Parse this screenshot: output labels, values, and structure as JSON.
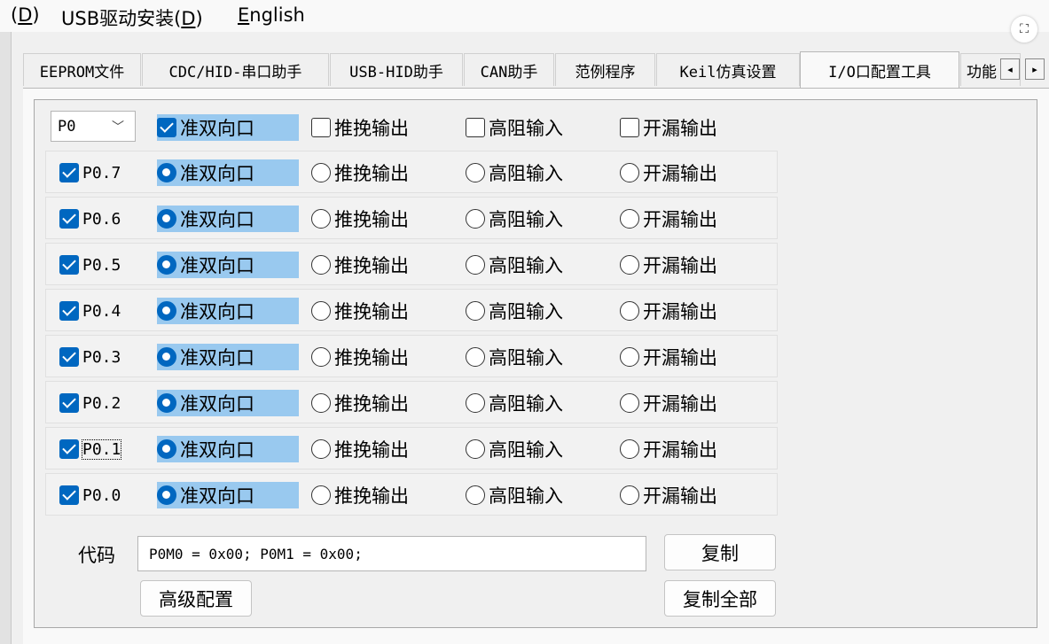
{
  "menu": {
    "items": [
      {
        "prefix": "",
        "hotkey": "D",
        "suffix": ")"
      },
      {
        "prefix": "USB驱动安装(",
        "hotkey": "D",
        "suffix": ")"
      },
      {
        "prefix": "",
        "hotkey": "E",
        "suffix": "nglish"
      }
    ]
  },
  "corner_icon": "⛶",
  "tabs": [
    {
      "label": "EEPROM文件"
    },
    {
      "label": "CDC/HID-串口助手"
    },
    {
      "label": "USB-HID助手"
    },
    {
      "label": "CAN助手"
    },
    {
      "label": "范例程序"
    },
    {
      "label": "Keil仿真设置"
    },
    {
      "label": "I/O口配置工具",
      "active": true
    },
    {
      "label": "功能"
    }
  ],
  "tab_scroll": {
    "left": "◂",
    "right": "▸"
  },
  "port_select": {
    "value": "P0",
    "chevron": "﹀"
  },
  "header_options": [
    {
      "label": "准双向口",
      "checked": true
    },
    {
      "label": "推挽输出",
      "checked": false
    },
    {
      "label": "高阻输入",
      "checked": false
    },
    {
      "label": "开漏输出",
      "checked": false
    }
  ],
  "mode_labels": [
    "准双向口",
    "推挽输出",
    "高阻输入",
    "开漏输出"
  ],
  "pins": [
    {
      "label": "P0.7",
      "enabled": true,
      "mode": 0
    },
    {
      "label": "P0.6",
      "enabled": true,
      "mode": 0
    },
    {
      "label": "P0.5",
      "enabled": true,
      "mode": 0
    },
    {
      "label": "P0.4",
      "enabled": true,
      "mode": 0
    },
    {
      "label": "P0.3",
      "enabled": true,
      "mode": 0
    },
    {
      "label": "P0.2",
      "enabled": true,
      "mode": 0
    },
    {
      "label": "P0.1",
      "enabled": true,
      "mode": 0,
      "focused": true
    },
    {
      "label": "P0.0",
      "enabled": true,
      "mode": 0
    }
  ],
  "code": {
    "label": "代码",
    "value": "P0M0 = 0x00; P0M1 = 0x00;"
  },
  "buttons": {
    "copy": "复制",
    "copy_all": "复制全部",
    "advanced": "高级配置"
  },
  "colors": {
    "accent": "#0067c0",
    "highlight": "#99c9ef"
  }
}
